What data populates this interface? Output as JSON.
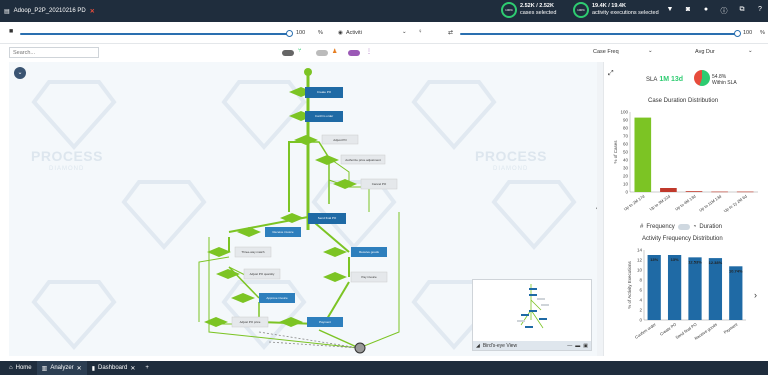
{
  "app": {
    "title": "Adoop_P2P_20210216 PD"
  },
  "header_stats": {
    "cases": {
      "value": "2.52K / 2.52K",
      "label": "cases selected",
      "donut": "100%"
    },
    "activities": {
      "value": "19.4K / 19.4K",
      "label": "activity executions selected",
      "donut": "100%"
    }
  },
  "header_icons": [
    "filter-icon",
    "camera-icon",
    "drop-icon",
    "info-icon",
    "export-icon",
    "help-icon"
  ],
  "toolbar": {
    "left_slider_value": "100",
    "left_slider_unit": "%",
    "activity_dropdown": "Activiti",
    "right_slider_value": "100",
    "right_slider_unit": "%"
  },
  "filters": {
    "search_placeholder": "Search...",
    "metric_dropdown": "Case Freq",
    "agg_dropdown": "Avg Dur"
  },
  "process_map": {
    "nodes": [
      "Create PO",
      "Confirm order",
      "Adjust PO",
      "Authorize price adjustment",
      "Cancel PO",
      "Send final PO",
      "Receive invoice",
      "Three-way match",
      "Adjust PO quantity",
      "Approve invoice",
      "Receive goods",
      "Pay invoice",
      "Adjust PO price",
      "Payment"
    ],
    "birdseye_label": "Bird's-eye View"
  },
  "watermark": {
    "text": "PROCESS",
    "sub": "DIAMOND"
  },
  "sla": {
    "label": "SLA",
    "value": "1M 13d",
    "within_pct": "54.8%",
    "within_label": "Within SLA"
  },
  "chart_data": [
    {
      "type": "bar",
      "title": "Case Duration Distribution",
      "ylabel": "% of Cases",
      "categories": [
        "Up to 2M 17d",
        "Up to 3M 22d",
        "Up to 4M 13d",
        "Up to 11M 13d",
        "Up to 1y 2M 6d"
      ],
      "values": [
        93,
        5,
        1,
        0.5,
        0.5
      ],
      "ylim": [
        0,
        100
      ],
      "yticks": [
        0,
        10,
        20,
        30,
        40,
        50,
        60,
        70,
        80,
        90,
        100
      ],
      "colors": [
        "#7cc424",
        "#c0392b",
        "#c0392b",
        "#c0392b",
        "#c0392b"
      ]
    },
    {
      "type": "bar",
      "title": "Activity Frequency Distribution",
      "ylabel": "% of Activity Executions",
      "categories": [
        "Confirm order",
        "Create PO",
        "Send final PO",
        "Receive goods",
        "Payment"
      ],
      "values": [
        13,
        13,
        12.53,
        12.38,
        10.74
      ],
      "labels": [
        "13%",
        "13%",
        "12.53%",
        "12.38%",
        "10.74%"
      ],
      "ylim": [
        0,
        14
      ],
      "yticks": [
        0,
        2,
        4,
        6,
        8,
        10,
        12,
        14
      ],
      "colors": [
        "#1f6aa5",
        "#1f6aa5",
        "#1f6aa5",
        "#1f6aa5",
        "#1f6aa5"
      ]
    }
  ],
  "toggles": {
    "frequency_label": "Frequency",
    "duration_label": "Duration"
  },
  "bottom_tabs": [
    {
      "label": "Home"
    },
    {
      "label": "Analyzer"
    },
    {
      "label": "Dashboard"
    }
  ]
}
